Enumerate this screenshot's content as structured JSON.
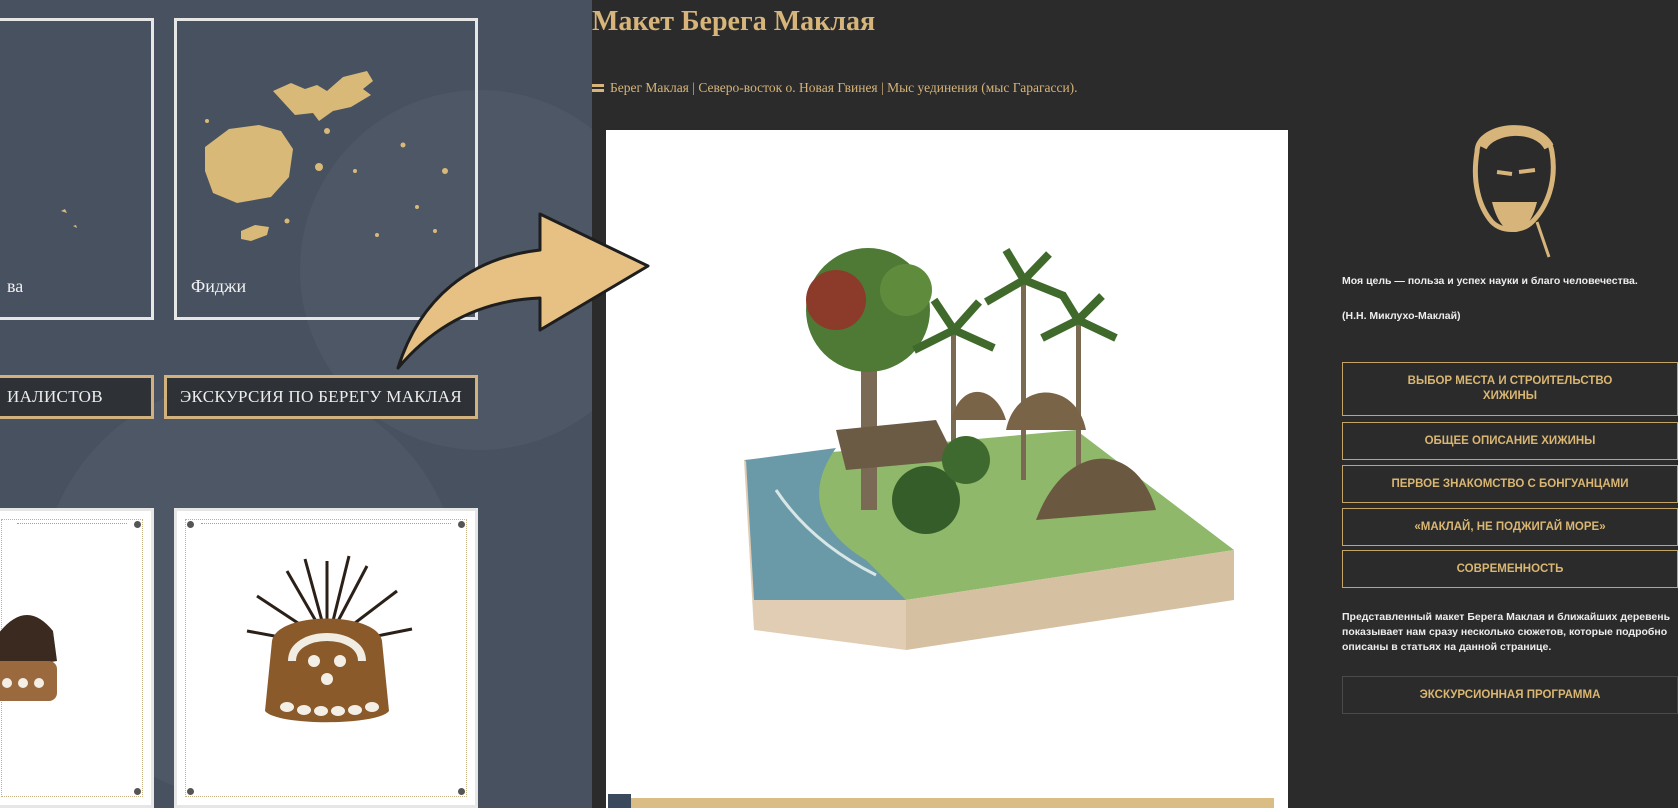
{
  "left": {
    "regions": [
      {
        "name": "ва"
      },
      {
        "name": "Фиджи"
      }
    ],
    "buttons": [
      {
        "label": "ИАЛИСТОВ"
      },
      {
        "label": "ЭКСКУРСИЯ ПО БЕРЕГУ МАКЛАЯ"
      }
    ]
  },
  "page": {
    "title": "Макет Берега Маклая",
    "breadcrumb": "Берег Маклая | Северо-восток о. Новая Гвинея | Мыс уединения (мыс Гарагасси).",
    "viewer": {
      "progress": 0.035
    }
  },
  "sidebar": {
    "quote": "Моя цель — польза и успех науки и благо человечества.",
    "quote_author": "(Н.Н. Миклухо-Маклай)",
    "buttons": [
      {
        "label": "ВЫБОР МЕСТА И СТРОИТЕЛЬСТВО ХИЖИНЫ"
      },
      {
        "label": "ОБЩЕЕ ОПИСАНИЕ ХИЖИНЫ"
      },
      {
        "label": "ПЕРВОЕ ЗНАКОМСТВО С БОНГУАНЦАМИ"
      },
      {
        "label": "«МАКЛАЙ, НЕ ПОДЖИГАЙ МОРЕ»"
      },
      {
        "label": "СОВРЕМЕННОСТЬ"
      }
    ],
    "description": "Представленный макет Берега Маклая и ближайших деревень показывает нам сразу несколько сюжетов, которые подробно описаны в статьях на данной странице.",
    "tour_button": "ЭКСКУРСИОННАЯ ПРОГРАММА"
  },
  "colors": {
    "accent": "#d6b47a",
    "left_bg": "#475160",
    "page_bg": "#2b2b2b",
    "arrow": "#e6c183"
  }
}
